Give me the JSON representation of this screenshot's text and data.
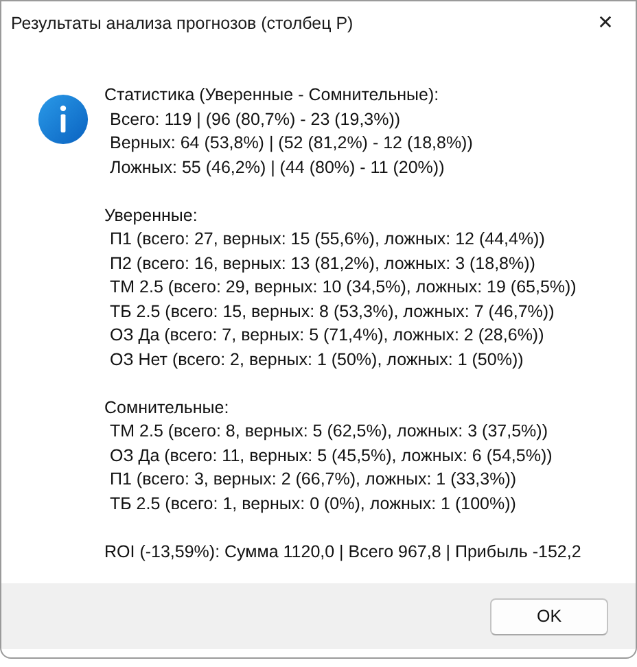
{
  "window": {
    "title": "Результаты анализа прогнозов (столбец P)",
    "close": "✕"
  },
  "message": {
    "sections": [
      {
        "heading": "Статистика (Уверенные - Сомнительные):",
        "lines": [
          "Всего: 119 | (96 (80,7%) - 23 (19,3%))",
          "Верных: 64 (53,8%) | (52 (81,2%) - 12 (18,8%))",
          "Ложных: 55 (46,2%) | (44 (80%) - 11 (20%))"
        ]
      },
      {
        "heading": "Уверенные:",
        "lines": [
          "П1 (всего: 27, верных: 15 (55,6%), ложных: 12 (44,4%))",
          "П2 (всего: 16, верных: 13 (81,2%), ложных: 3 (18,8%))",
          "ТМ 2.5 (всего: 29, верных: 10 (34,5%), ложных: 19 (65,5%))",
          "ТБ 2.5 (всего: 15, верных: 8 (53,3%), ложных: 7 (46,7%))",
          "ОЗ Да (всего: 7, верных: 5 (71,4%), ложных: 2 (28,6%))",
          "ОЗ Нет (всего: 2, верных: 1 (50%), ложных: 1 (50%))"
        ]
      },
      {
        "heading": "Сомнительные:",
        "lines": [
          "ТМ 2.5 (всего: 8, верных: 5 (62,5%), ложных: 3 (37,5%))",
          "ОЗ Да (всего: 11, верных: 5 (45,5%), ложных: 6 (54,5%))",
          "П1 (всего: 3, верных: 2 (66,7%), ложных: 1 (33,3%))",
          "ТБ 2.5 (всего: 1, верных: 0 (0%), ложных: 1 (100%))"
        ]
      },
      {
        "heading": "ROI (-13,59%): Сумма 1120,0 | Всего 967,8 | Прибыль -152,2"
      }
    ]
  },
  "buttons": [
    "OK"
  ]
}
